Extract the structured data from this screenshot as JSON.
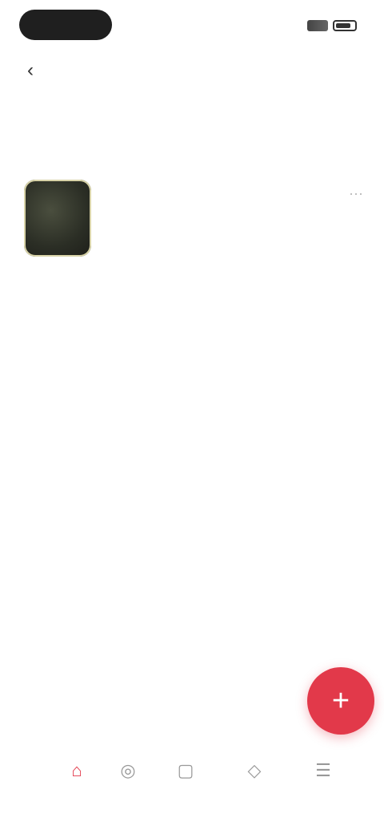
{
  "status": {
    "text": ""
  },
  "top_tabs": [
    {
      "label": "",
      "active": true
    },
    {
      "label": "",
      "active": false
    }
  ],
  "stats": [
    {
      "label": "",
      "value": ""
    },
    {
      "label": "",
      "value": ""
    },
    {
      "label": "",
      "value": ""
    },
    {
      "label": "",
      "value": ""
    }
  ],
  "list": [
    {
      "title": "",
      "subtitle": ""
    }
  ],
  "fab": {
    "icon": "plus-icon"
  },
  "bottom_nav": [
    {
      "label": "",
      "icon": "home-icon",
      "active": true
    },
    {
      "label": "",
      "icon": "discover-icon",
      "active": false
    },
    {
      "label": "",
      "icon": "chat-icon",
      "active": false
    },
    {
      "label": "",
      "icon": "profile-icon",
      "active": false
    },
    {
      "label": "",
      "icon": "more-icon",
      "active": false
    }
  ],
  "colors": {
    "accent": "#e2394a",
    "text_primary": "#222222",
    "text_muted": "#999999"
  }
}
